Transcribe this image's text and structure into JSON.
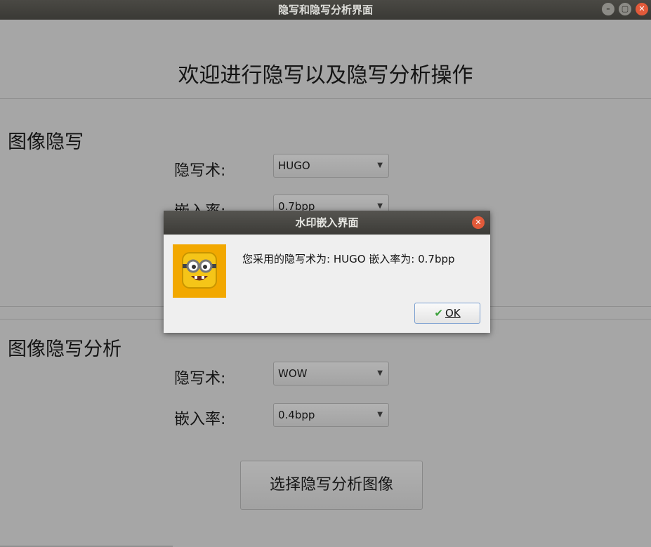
{
  "window": {
    "title": "隐写和隐写分析界面",
    "buttons": {
      "minimize": "–",
      "maximize": "▢",
      "close": "✕"
    }
  },
  "main": {
    "welcome": "欢迎进行隐写以及隐写分析操作",
    "stego": {
      "title": "图像隐写",
      "method_label": "隐写术:",
      "method_value": "HUGO",
      "rate_label": "嵌入率:",
      "rate_value": "0.7bpp"
    },
    "analysis": {
      "title": "图像隐写分析",
      "method_label": "隐写术:",
      "method_value": "WOW",
      "rate_label": "嵌入率:",
      "rate_value": "0.4bpp",
      "select_button": "选择隐写分析图像"
    }
  },
  "dialog": {
    "title": "水印嵌入界面",
    "close": "✕",
    "message": "您采用的隐写术为: HUGO 嵌入率为: 0.7bpp",
    "ok_label": "OK",
    "ok_icon": "✔"
  },
  "colors": {
    "accent_close": "#e25a3a",
    "avatar_bg": "#f2a800"
  }
}
